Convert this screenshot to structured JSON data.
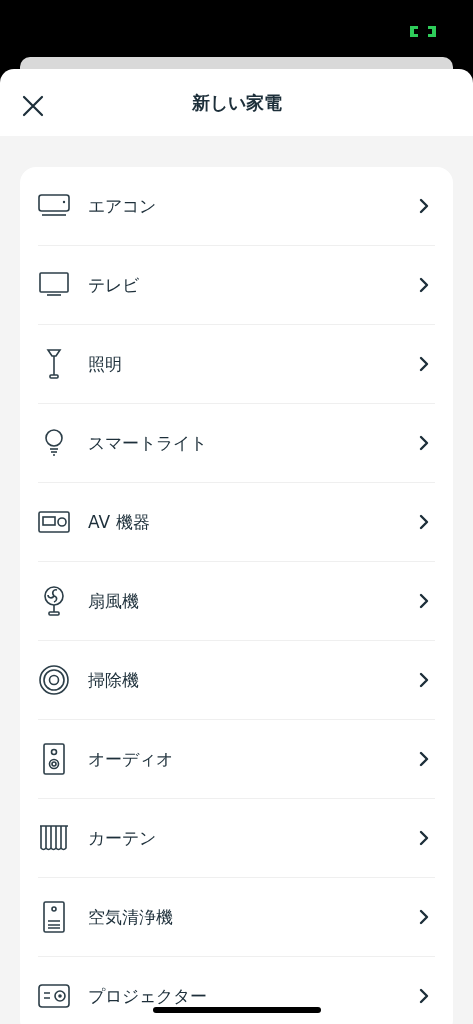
{
  "header": {
    "title": "新しい家電"
  },
  "devices": [
    {
      "label": "エアコン"
    },
    {
      "label": "テレビ"
    },
    {
      "label": "照明"
    },
    {
      "label": "スマートライト"
    },
    {
      "label": "AV 機器"
    },
    {
      "label": "扇風機"
    },
    {
      "label": "掃除機"
    },
    {
      "label": "オーディオ"
    },
    {
      "label": "カーテン"
    },
    {
      "label": "空気清浄機"
    },
    {
      "label": "プロジェクター"
    }
  ]
}
